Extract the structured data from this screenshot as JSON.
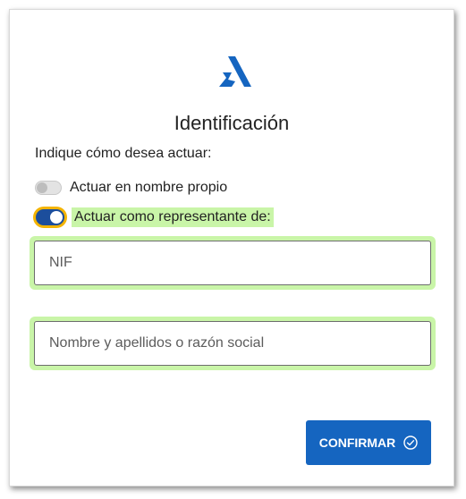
{
  "header": {
    "logo_icon": "aeat-x-logo-icon",
    "title": "Identificación"
  },
  "form": {
    "prompt": "Indique cómo desea actuar:",
    "options": [
      {
        "label": "Actuar en nombre propio",
        "checked": false
      },
      {
        "label": "Actuar como representante de:",
        "checked": true
      }
    ],
    "nif_placeholder": "NIF",
    "name_placeholder": "Nombre y apellidos o razón social",
    "confirm_label": "CONFIRMAR",
    "confirm_icon": "check-circle-icon"
  },
  "colors": {
    "primary": "#1565c0",
    "toggle_on": "#1c4e9c",
    "focus_ring": "#f4b400",
    "highlight": "#c9f5a8"
  }
}
